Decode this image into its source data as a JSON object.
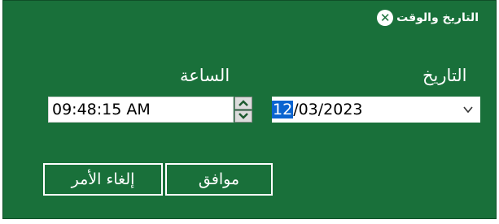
{
  "dialog": {
    "title": "التاريخ والوقت",
    "close_symbol": "✕"
  },
  "labels": {
    "time": "الساعة",
    "date": "التاريخ"
  },
  "time": {
    "value": "09:48:15 AM"
  },
  "date": {
    "day": "12",
    "rest": "/03/2023"
  },
  "buttons": {
    "ok": "موافق",
    "cancel": "إلغاء الأمر"
  },
  "colors": {
    "panel": "#19703a",
    "selection": "#0a64d0"
  },
  "icons": {
    "close": "close-icon",
    "spin_up": "chevron-up-icon",
    "spin_down": "chevron-down-icon",
    "dropdown": "chevron-down-icon"
  }
}
